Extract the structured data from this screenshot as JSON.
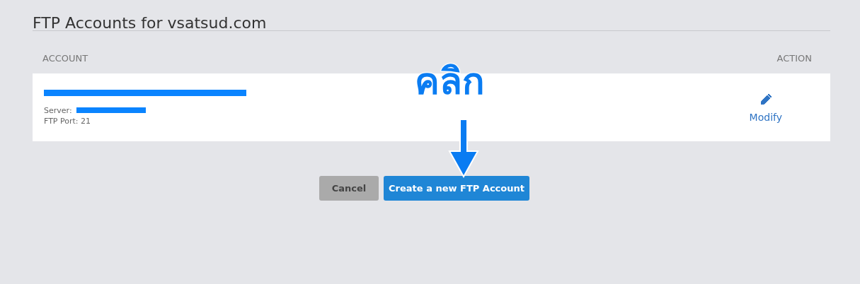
{
  "title": "FTP Accounts for vsatsud.com",
  "table": {
    "columns": [
      "ACCOUNT",
      "ACTION"
    ],
    "rows": [
      {
        "server_label": "Server:",
        "port": "FTP Port: 21",
        "action": "Modify"
      }
    ]
  },
  "buttons": [
    {
      "label": "Cancel",
      "kind": "secondary"
    },
    {
      "label": "Create a new FTP Account",
      "kind": "primary"
    }
  ],
  "annotation": {
    "text": "คลิก"
  }
}
